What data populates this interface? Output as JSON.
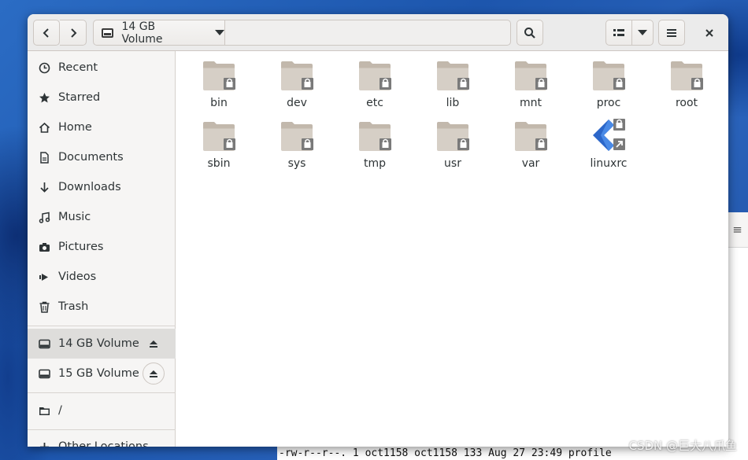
{
  "window": {
    "path_segment": "14 GB Volume"
  },
  "sidebar": {
    "places": [
      {
        "label": "Recent",
        "icon": "clock-icon"
      },
      {
        "label": "Starred",
        "icon": "star-icon"
      },
      {
        "label": "Home",
        "icon": "home-icon"
      },
      {
        "label": "Documents",
        "icon": "document-icon"
      },
      {
        "label": "Downloads",
        "icon": "download-icon"
      },
      {
        "label": "Music",
        "icon": "music-icon"
      },
      {
        "label": "Pictures",
        "icon": "camera-icon"
      },
      {
        "label": "Videos",
        "icon": "video-icon"
      },
      {
        "label": "Trash",
        "icon": "trash-icon"
      }
    ],
    "volumes": [
      {
        "label": "14 GB Volume",
        "icon": "drive-icon",
        "active": true
      },
      {
        "label": "15 GB Volume",
        "icon": "drive-icon",
        "active": false
      }
    ],
    "root_label": "/",
    "other_label": "Other Locations"
  },
  "files": [
    {
      "name": "bin",
      "type": "folder-locked"
    },
    {
      "name": "dev",
      "type": "folder-locked"
    },
    {
      "name": "etc",
      "type": "folder-locked"
    },
    {
      "name": "lib",
      "type": "folder-locked"
    },
    {
      "name": "mnt",
      "type": "folder-locked"
    },
    {
      "name": "proc",
      "type": "folder-locked"
    },
    {
      "name": "root",
      "type": "folder-locked"
    },
    {
      "name": "sbin",
      "type": "folder-locked"
    },
    {
      "name": "sys",
      "type": "folder-locked"
    },
    {
      "name": "tmp",
      "type": "folder-locked"
    },
    {
      "name": "usr",
      "type": "folder-locked"
    },
    {
      "name": "var",
      "type": "folder-locked"
    },
    {
      "name": "linuxrc",
      "type": "symlink-executable"
    }
  ],
  "terminal": {
    "line": "-rw-r--r--. 1 oct1158 oct1158 133 Aug 27 23:49 profile"
  },
  "watermark": "CSDN @巨大八爪鱼",
  "colors": {
    "folder": "#d6cfc6",
    "folder_tab": "#c2b8ac",
    "lock_badge": "#7a7a7a",
    "active_sidebar": "#dedddb",
    "wallpaper": "#1f5aa8"
  }
}
